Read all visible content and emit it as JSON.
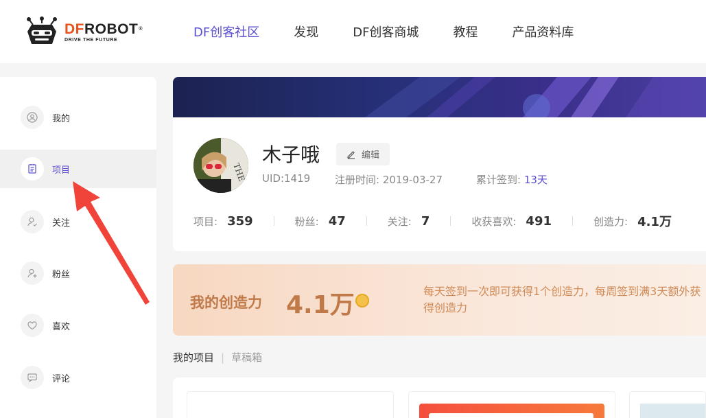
{
  "brand": {
    "logo_df": "DF",
    "logo_rest": "ROBOT",
    "tagline": "DRIVE THE FUTURE"
  },
  "nav": [
    {
      "label": "DF创客社区",
      "active": true
    },
    {
      "label": "发现",
      "active": false
    },
    {
      "label": "DF创客商城",
      "active": false
    },
    {
      "label": "教程",
      "active": false
    },
    {
      "label": "产品资料库",
      "active": false
    }
  ],
  "sidebar": {
    "items": [
      {
        "label": "我的",
        "icon": "user-circle-icon"
      },
      {
        "label": "项目",
        "icon": "document-icon",
        "active": true
      },
      {
        "label": "关注",
        "icon": "user-follow-icon"
      },
      {
        "label": "粉丝",
        "icon": "user-plus-icon"
      },
      {
        "label": "喜欢",
        "icon": "heart-icon"
      },
      {
        "label": "评论",
        "icon": "comment-icon"
      }
    ]
  },
  "profile": {
    "username": "木子哦",
    "edit_label": "编辑",
    "uid": "UID:1419",
    "register_label": "注册时间:",
    "register_date": "2019-03-27",
    "checkin_label": "累计签到:",
    "checkin_days": "13天",
    "stats": [
      {
        "label": "项目:",
        "value": "359"
      },
      {
        "label": "粉丝:",
        "value": "47"
      },
      {
        "label": "关注:",
        "value": "7"
      },
      {
        "label": "收获喜欢:",
        "value": "491"
      },
      {
        "label": "创造力:",
        "value": "4.1万"
      }
    ]
  },
  "creation": {
    "title": "我的创造力",
    "value": "4.1万",
    "description": "每天签到一次即可获得1个创造力，每周签到满3天额外获得创造力"
  },
  "tabs": [
    {
      "label": "我的项目",
      "active": true
    },
    {
      "label": "草稿箱",
      "active": false
    }
  ],
  "colors": {
    "accent": "#5a4fcf",
    "brand_orange": "#e8531d",
    "power_text": "#c07a4a"
  }
}
